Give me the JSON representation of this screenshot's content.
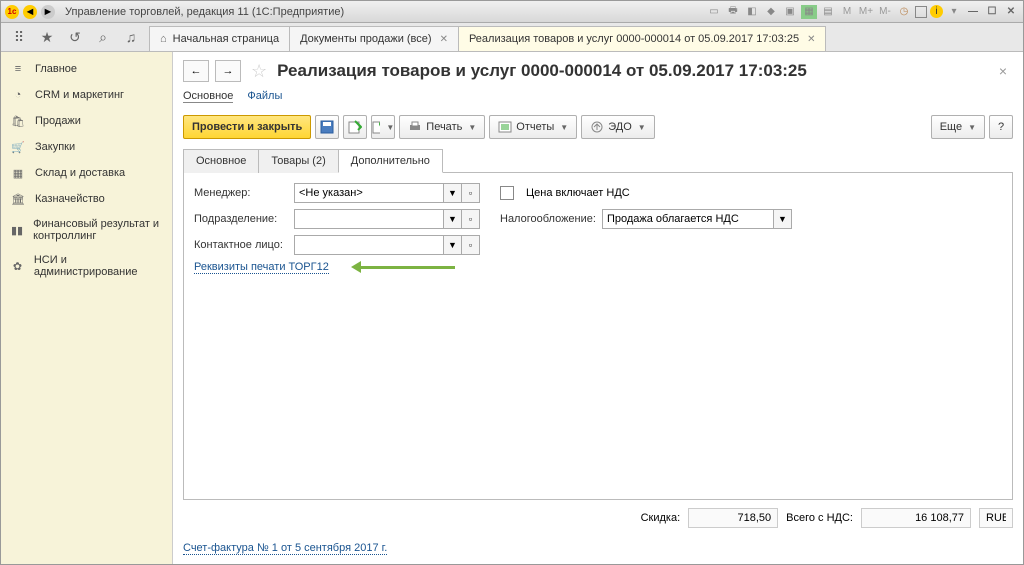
{
  "titlebar": {
    "app_title": "Управление торговлей, редакция 11  (1С:Предприятие)"
  },
  "top_tabs": {
    "home": "Начальная страница",
    "tab1": "Документы продажи (все)",
    "tab2": "Реализация товаров и услуг 0000-000014 от 05.09.2017 17:03:25"
  },
  "sidebar": {
    "items": [
      {
        "label": "Главное"
      },
      {
        "label": "CRM и маркетинг"
      },
      {
        "label": "Продажи"
      },
      {
        "label": "Закупки"
      },
      {
        "label": "Склад и доставка"
      },
      {
        "label": "Казначейство"
      },
      {
        "label": "Финансовый результат и контроллинг"
      },
      {
        "label": "НСИ и администрирование"
      }
    ]
  },
  "doc": {
    "title": "Реализация товаров и услуг 0000-000014 от 05.09.2017 17:03:25",
    "subnav_main": "Основное",
    "subnav_files": "Файлы",
    "btn_post": "Провести и закрыть",
    "btn_print": "Печать",
    "btn_reports": "Отчеты",
    "btn_edo": "ЭДО",
    "btn_more": "Еще",
    "inner_tabs": {
      "main": "Основное",
      "goods": "Товары (2)",
      "extra": "Дополнительно"
    },
    "form": {
      "manager_lbl": "Менеджер:",
      "manager_val": "<Не указан>",
      "price_vat_lbl": "Цена включает НДС",
      "division_lbl": "Подразделение:",
      "division_val": "",
      "tax_lbl": "Налогообложение:",
      "tax_val": "Продажа облагается НДС",
      "contact_lbl": "Контактное лицо:",
      "contact_val": "",
      "torg12_link": "Реквизиты печати ТОРГ12"
    },
    "totals": {
      "discount_lbl": "Скидка:",
      "discount_val": "718,50",
      "total_lbl": "Всего с НДС:",
      "total_val": "16 108,77",
      "currency": "RUB"
    },
    "invoice_link": "Счет-фактура № 1 от 5 сентября 2017 г."
  }
}
